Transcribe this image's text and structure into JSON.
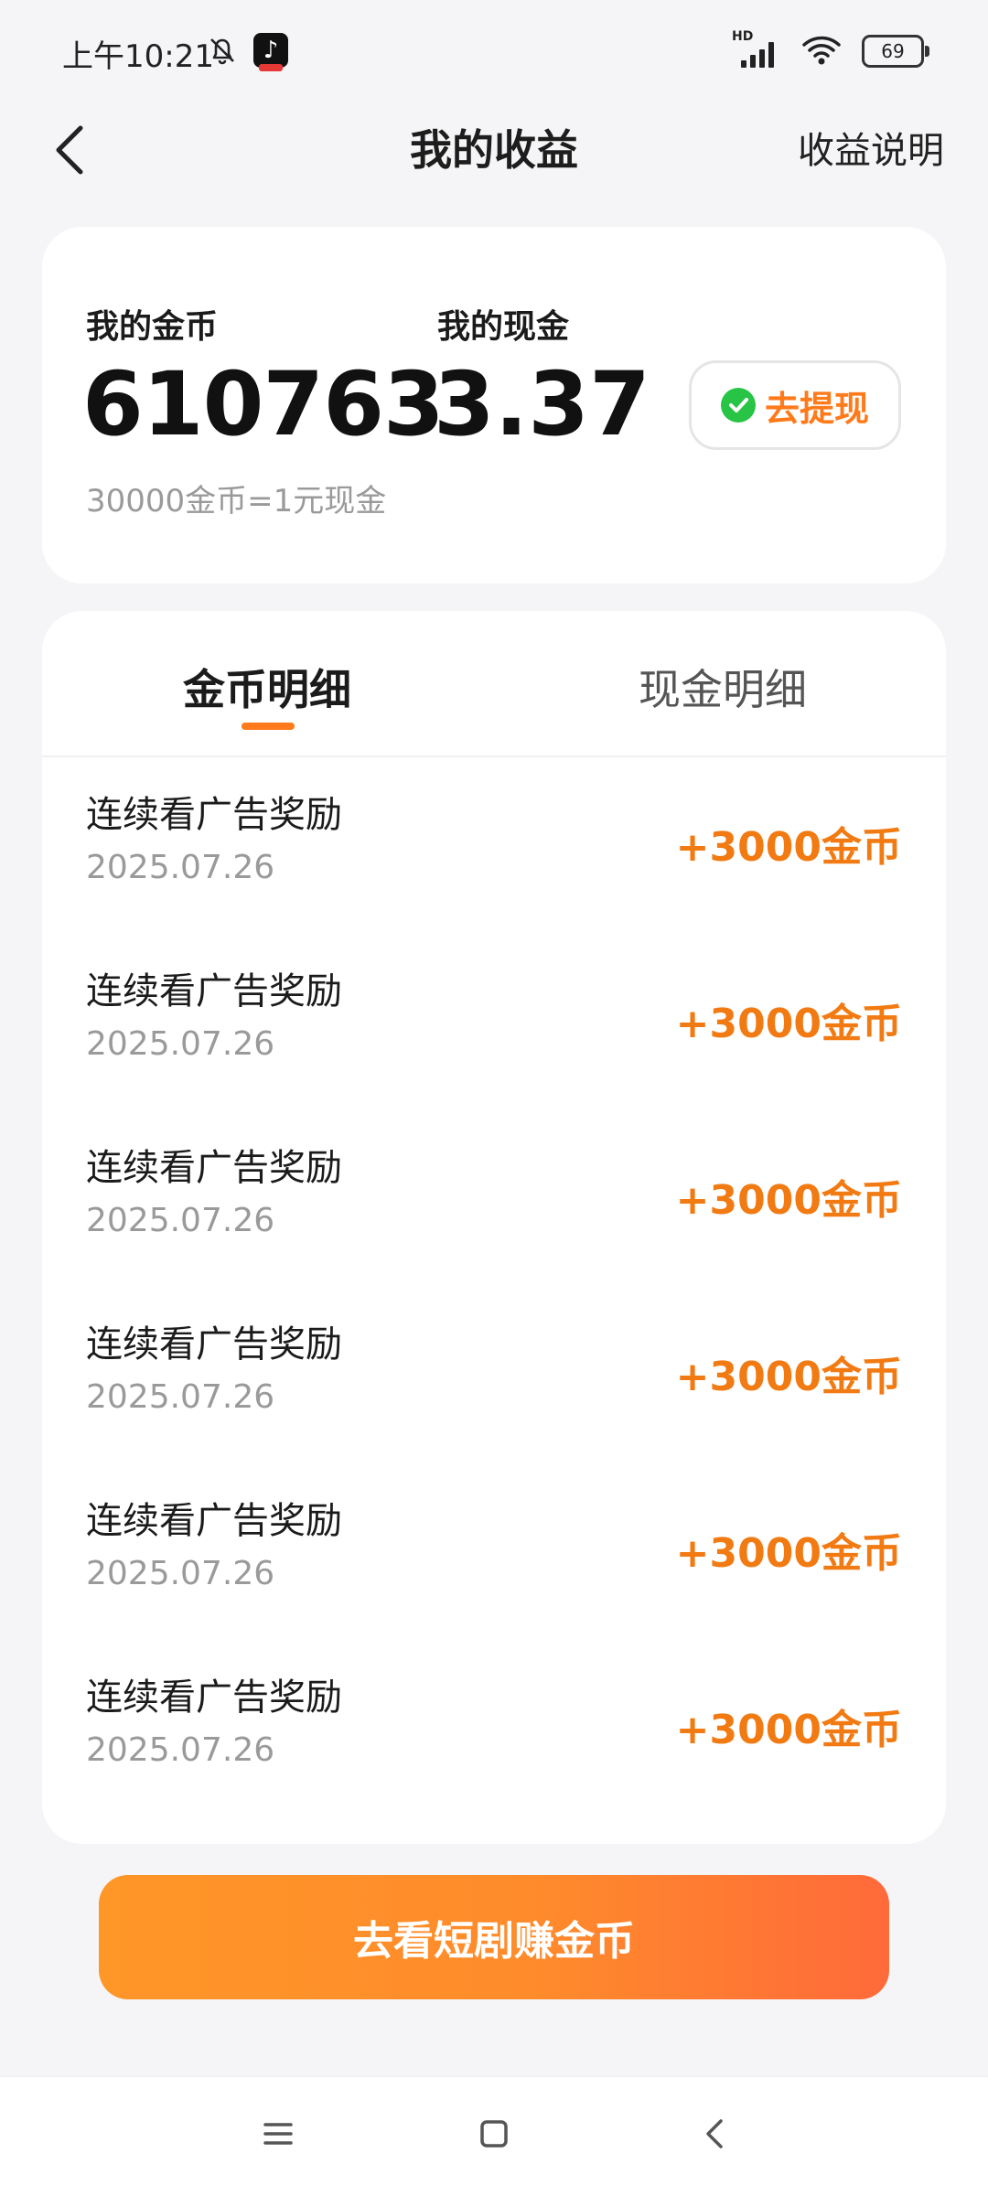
{
  "status_bar": {
    "time": "上午10:21",
    "network_badge": "HD",
    "battery_level": "69"
  },
  "header": {
    "title": "我的收益",
    "explain_link": "收益说明",
    "back_icon": "chevron-left-icon"
  },
  "summary": {
    "coins_label": "我的金币",
    "coins_value": "610763",
    "cash_label": "我的现金",
    "cash_value": "3.37",
    "exchange_rate": "30000金币=1元现金",
    "withdraw_button": "去提现",
    "withdraw_icon": "wechat-icon"
  },
  "tabs": [
    {
      "label": "金币明细",
      "active": true
    },
    {
      "label": "现金明细",
      "active": false
    }
  ],
  "records": [
    {
      "title": "连续看广告奖励",
      "date": "2025.07.26",
      "amount": "+3000金币"
    },
    {
      "title": "连续看广告奖励",
      "date": "2025.07.26",
      "amount": "+3000金币"
    },
    {
      "title": "连续看广告奖励",
      "date": "2025.07.26",
      "amount": "+3000金币"
    },
    {
      "title": "连续看广告奖励",
      "date": "2025.07.26",
      "amount": "+3000金币"
    },
    {
      "title": "连续看广告奖励",
      "date": "2025.07.26",
      "amount": "+3000金币"
    },
    {
      "title": "连续看广告奖励",
      "date": "2025.07.26",
      "amount": "+3000金币"
    }
  ],
  "cta_button": "去看短剧赚金币",
  "colors": {
    "accent": "#ff7a1a",
    "amount": "#f27a12",
    "cta_start": "#ff9628",
    "cta_end": "#ff6a3a",
    "background": "#f5f5f7"
  },
  "nav": [
    "menu-icon",
    "home-square-icon",
    "back-triangle-icon"
  ]
}
